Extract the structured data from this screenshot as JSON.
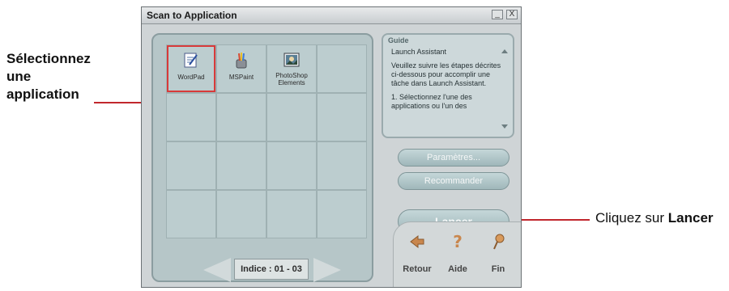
{
  "callouts": {
    "left_lines": [
      "Sélectionnez",
      "une",
      "application"
    ],
    "right_prefix": "Cliquez sur ",
    "right_bold": "Lancer",
    "line_color": "#c1272d"
  },
  "window": {
    "title": "Scan to Application",
    "minimize_glyph": "_",
    "close_glyph": "X"
  },
  "apps": [
    {
      "label": "WordPad",
      "icon": "wordpad-icon",
      "selected": true
    },
    {
      "label": "MSPaint",
      "icon": "mspaint-icon",
      "selected": false
    },
    {
      "label": "PhotoShop Elements",
      "icon": "photoshop-icon",
      "selected": false
    }
  ],
  "pager": {
    "index_label": "Indice : 01 - 03"
  },
  "guide": {
    "header": "Guide",
    "paragraphs": [
      "Launch Assistant",
      "Veuillez suivre les étapes décrites ci-dessous pour accomplir une tâche dans Launch Assistant.",
      "1. Sélectionnez l'une des applications ou l'un des"
    ]
  },
  "buttons": {
    "parametres": "Paramètres...",
    "recommander": "Recommander",
    "lancer": "Lancer"
  },
  "nav": {
    "retour": "Retour",
    "aide": "Aide",
    "fin": "Fin"
  },
  "colors": {
    "selection_outline": "#d83a3a",
    "button_teal": "#9fb7ba"
  }
}
